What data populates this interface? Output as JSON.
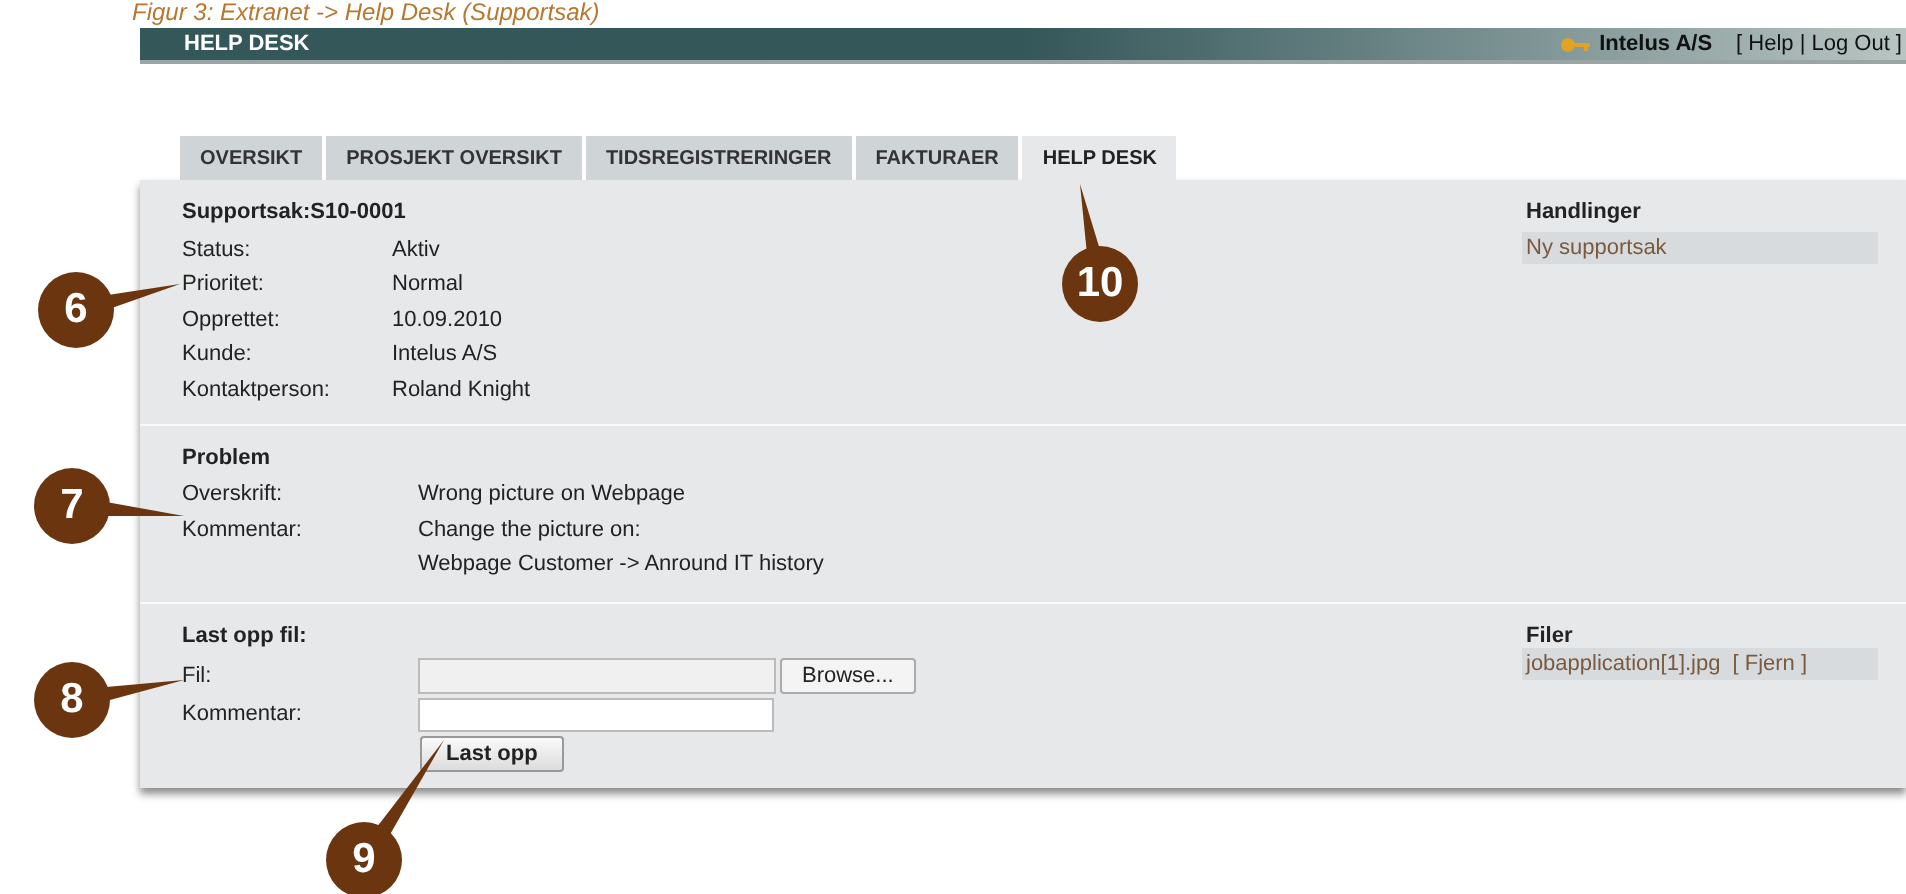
{
  "caption": "Figur 3: Extranet -> Help Desk (Supportsak)",
  "header": {
    "title": "HELP DESK",
    "company": "Intelus A/S",
    "links": [
      "[ Help | Log Out ]"
    ]
  },
  "tabs": [
    {
      "label": "OVERSIKT",
      "selected": false
    },
    {
      "label": "PROSJEKT OVERSIKT",
      "selected": false
    },
    {
      "label": "TIDSREGISTRERINGER",
      "selected": false
    },
    {
      "label": "FAKTURAER",
      "selected": false
    },
    {
      "label": "HELP DESK",
      "selected": true
    }
  ],
  "case": {
    "title": "Supportsak:S10-0001",
    "fields": [
      {
        "label": "Status:",
        "value": "Aktiv"
      },
      {
        "label": "Prioritet:",
        "value": "Normal"
      },
      {
        "label": "Opprettet:",
        "value": "10.09.2010"
      },
      {
        "label": "Kunde:",
        "value": "Intelus A/S"
      },
      {
        "label": "Kontaktperson:",
        "value": "Roland Knight"
      }
    ]
  },
  "actions": {
    "title": "Handlinger",
    "items": [
      "Ny supportsak"
    ]
  },
  "problem": {
    "title": "Problem",
    "fields": [
      {
        "label": "Overskrift:",
        "value": "Wrong picture on Webpage"
      },
      {
        "label": "Kommentar:",
        "value": "Change the picture on:"
      },
      {
        "value": "Webpage Customer -> Anround IT history"
      }
    ]
  },
  "upload": {
    "title": "Last opp fil:",
    "file_label": "Fil:",
    "browse_button": "Browse...",
    "comment_label": "Kommentar:",
    "submit_button": "Last opp"
  },
  "files": {
    "title": "Filer",
    "items": [
      {
        "name": "jobapplication[1].jpg",
        "remove": "[ Fjern ]"
      }
    ]
  },
  "callouts": [
    "6",
    "7",
    "8",
    "9",
    "10"
  ]
}
